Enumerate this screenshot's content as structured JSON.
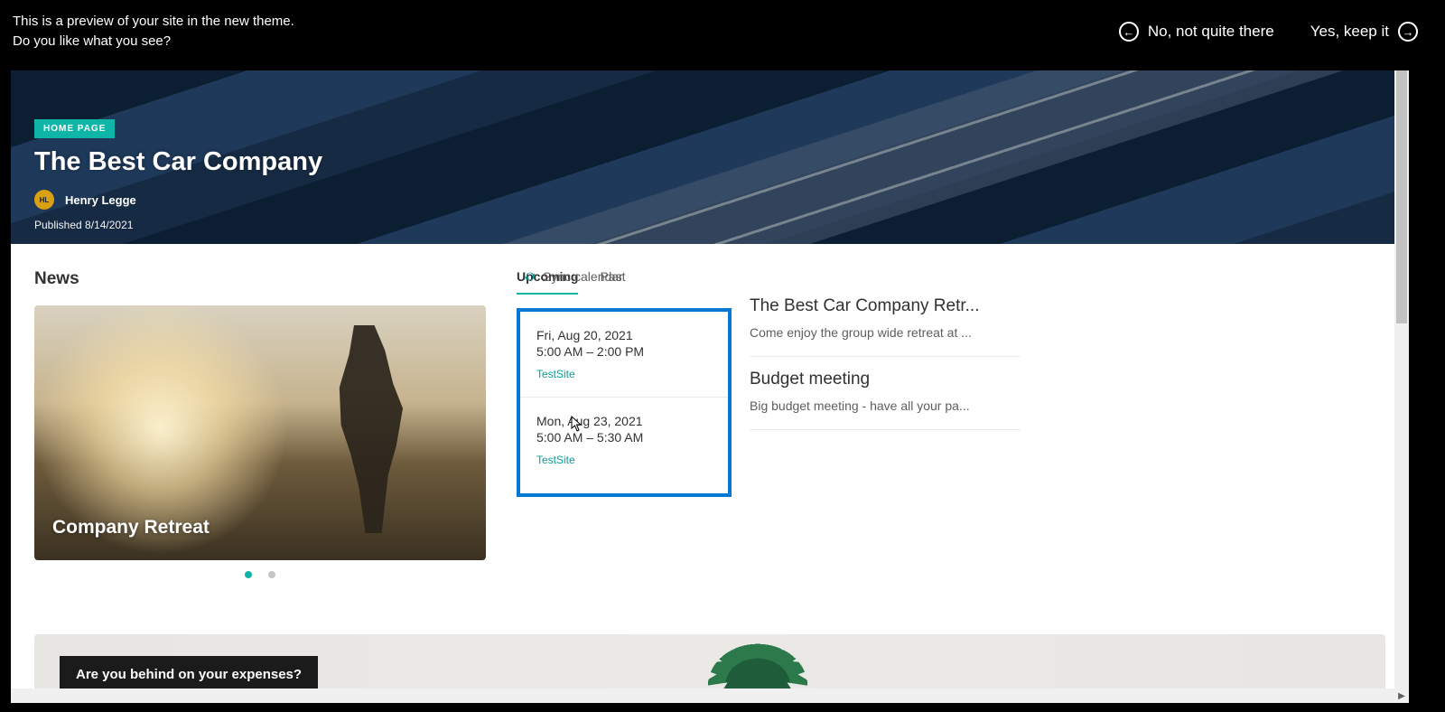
{
  "preview": {
    "line1": "This is a preview of your site in the new theme.",
    "line2": "Do you like what you see?",
    "no_label": "No, not quite there",
    "yes_label": "Yes, keep it"
  },
  "hero": {
    "badge": "HOME PAGE",
    "title": "The Best Car Company",
    "author_initials": "HL",
    "author_name": "Henry Legge",
    "published": "Published 8/14/2021"
  },
  "news": {
    "heading": "News",
    "card_title": "Company Retreat"
  },
  "events": {
    "tab_upcoming": "Upcoming",
    "tab_past": "Past",
    "sync_label": "Sync calendar",
    "items": [
      {
        "date": "Fri, Aug 20, 2021",
        "time": "5:00 AM – 2:00 PM",
        "site": "TestSite",
        "title": "The Best Car Company Retr...",
        "desc": "Come enjoy the group wide retreat at ..."
      },
      {
        "date": "Mon, Aug 23, 2021",
        "time": "5:00 AM – 5:30 AM",
        "site": "TestSite",
        "title": "Budget meeting",
        "desc": "Big budget meeting - have all your pa..."
      }
    ]
  },
  "lower": {
    "question": "Are you behind on your expenses?"
  },
  "colors": {
    "accent": "#0fb6a7",
    "highlight_border": "#0078d4"
  }
}
